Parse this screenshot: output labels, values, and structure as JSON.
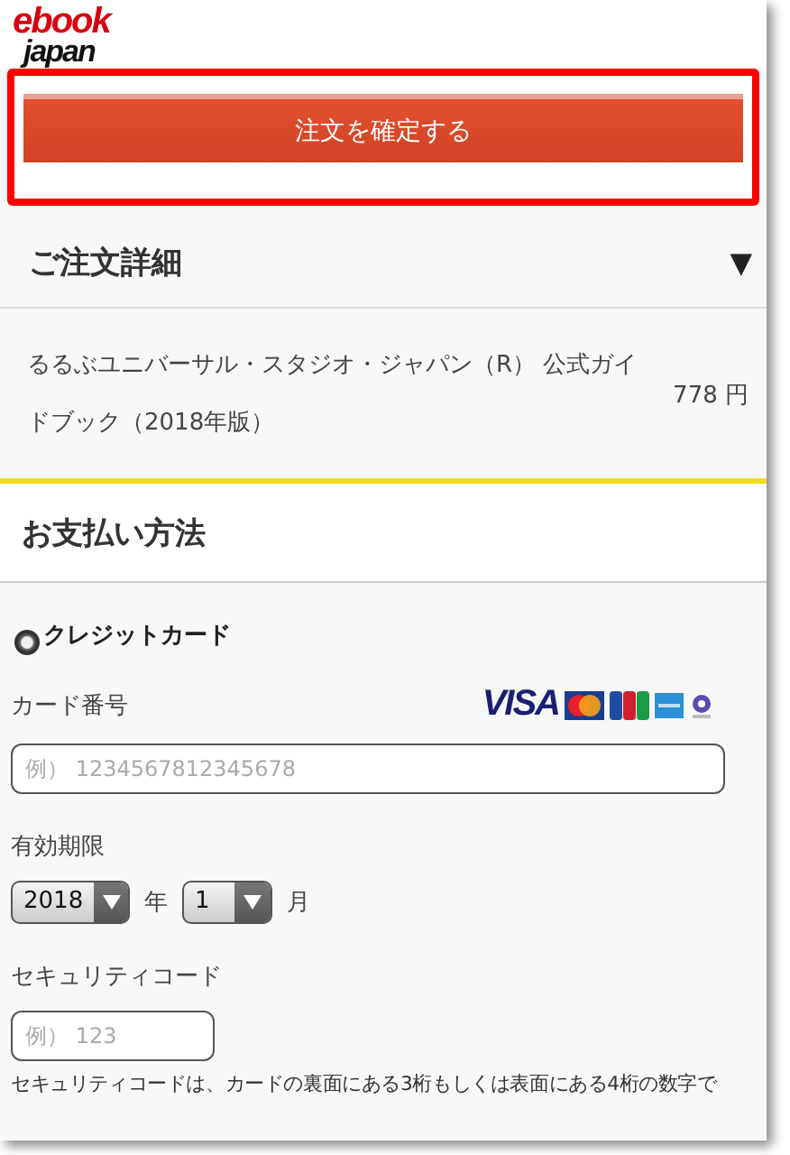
{
  "logo": {
    "line1": "ebook",
    "line2": "japan"
  },
  "confirm_button": "注文を確定する",
  "order_details": {
    "title": "ご注文詳細",
    "toggle": "▼",
    "expanded": true,
    "items": [
      {
        "title": "るるぶユニバーサル・スタジオ・ジャパン（R） 公式ガイドブック（2018年版）",
        "price": "778 円"
      }
    ]
  },
  "payment": {
    "title": "お支払い方法",
    "methods": [
      {
        "label": "クレジットカード",
        "selected": true
      }
    ],
    "card_number": {
      "label": "カード番号",
      "brand": "VISA",
      "placeholder": "例） 1234567812345678"
    },
    "expiry": {
      "label": "有効期限",
      "year": "2018",
      "year_unit": "年",
      "month": "1",
      "month_unit": "月"
    },
    "security": {
      "label": "セキュリティコード",
      "placeholder": "例） 123",
      "note": "セキュリティコードは、カードの裏面にある3桁もしくは表面にある4桁の数字で"
    }
  }
}
